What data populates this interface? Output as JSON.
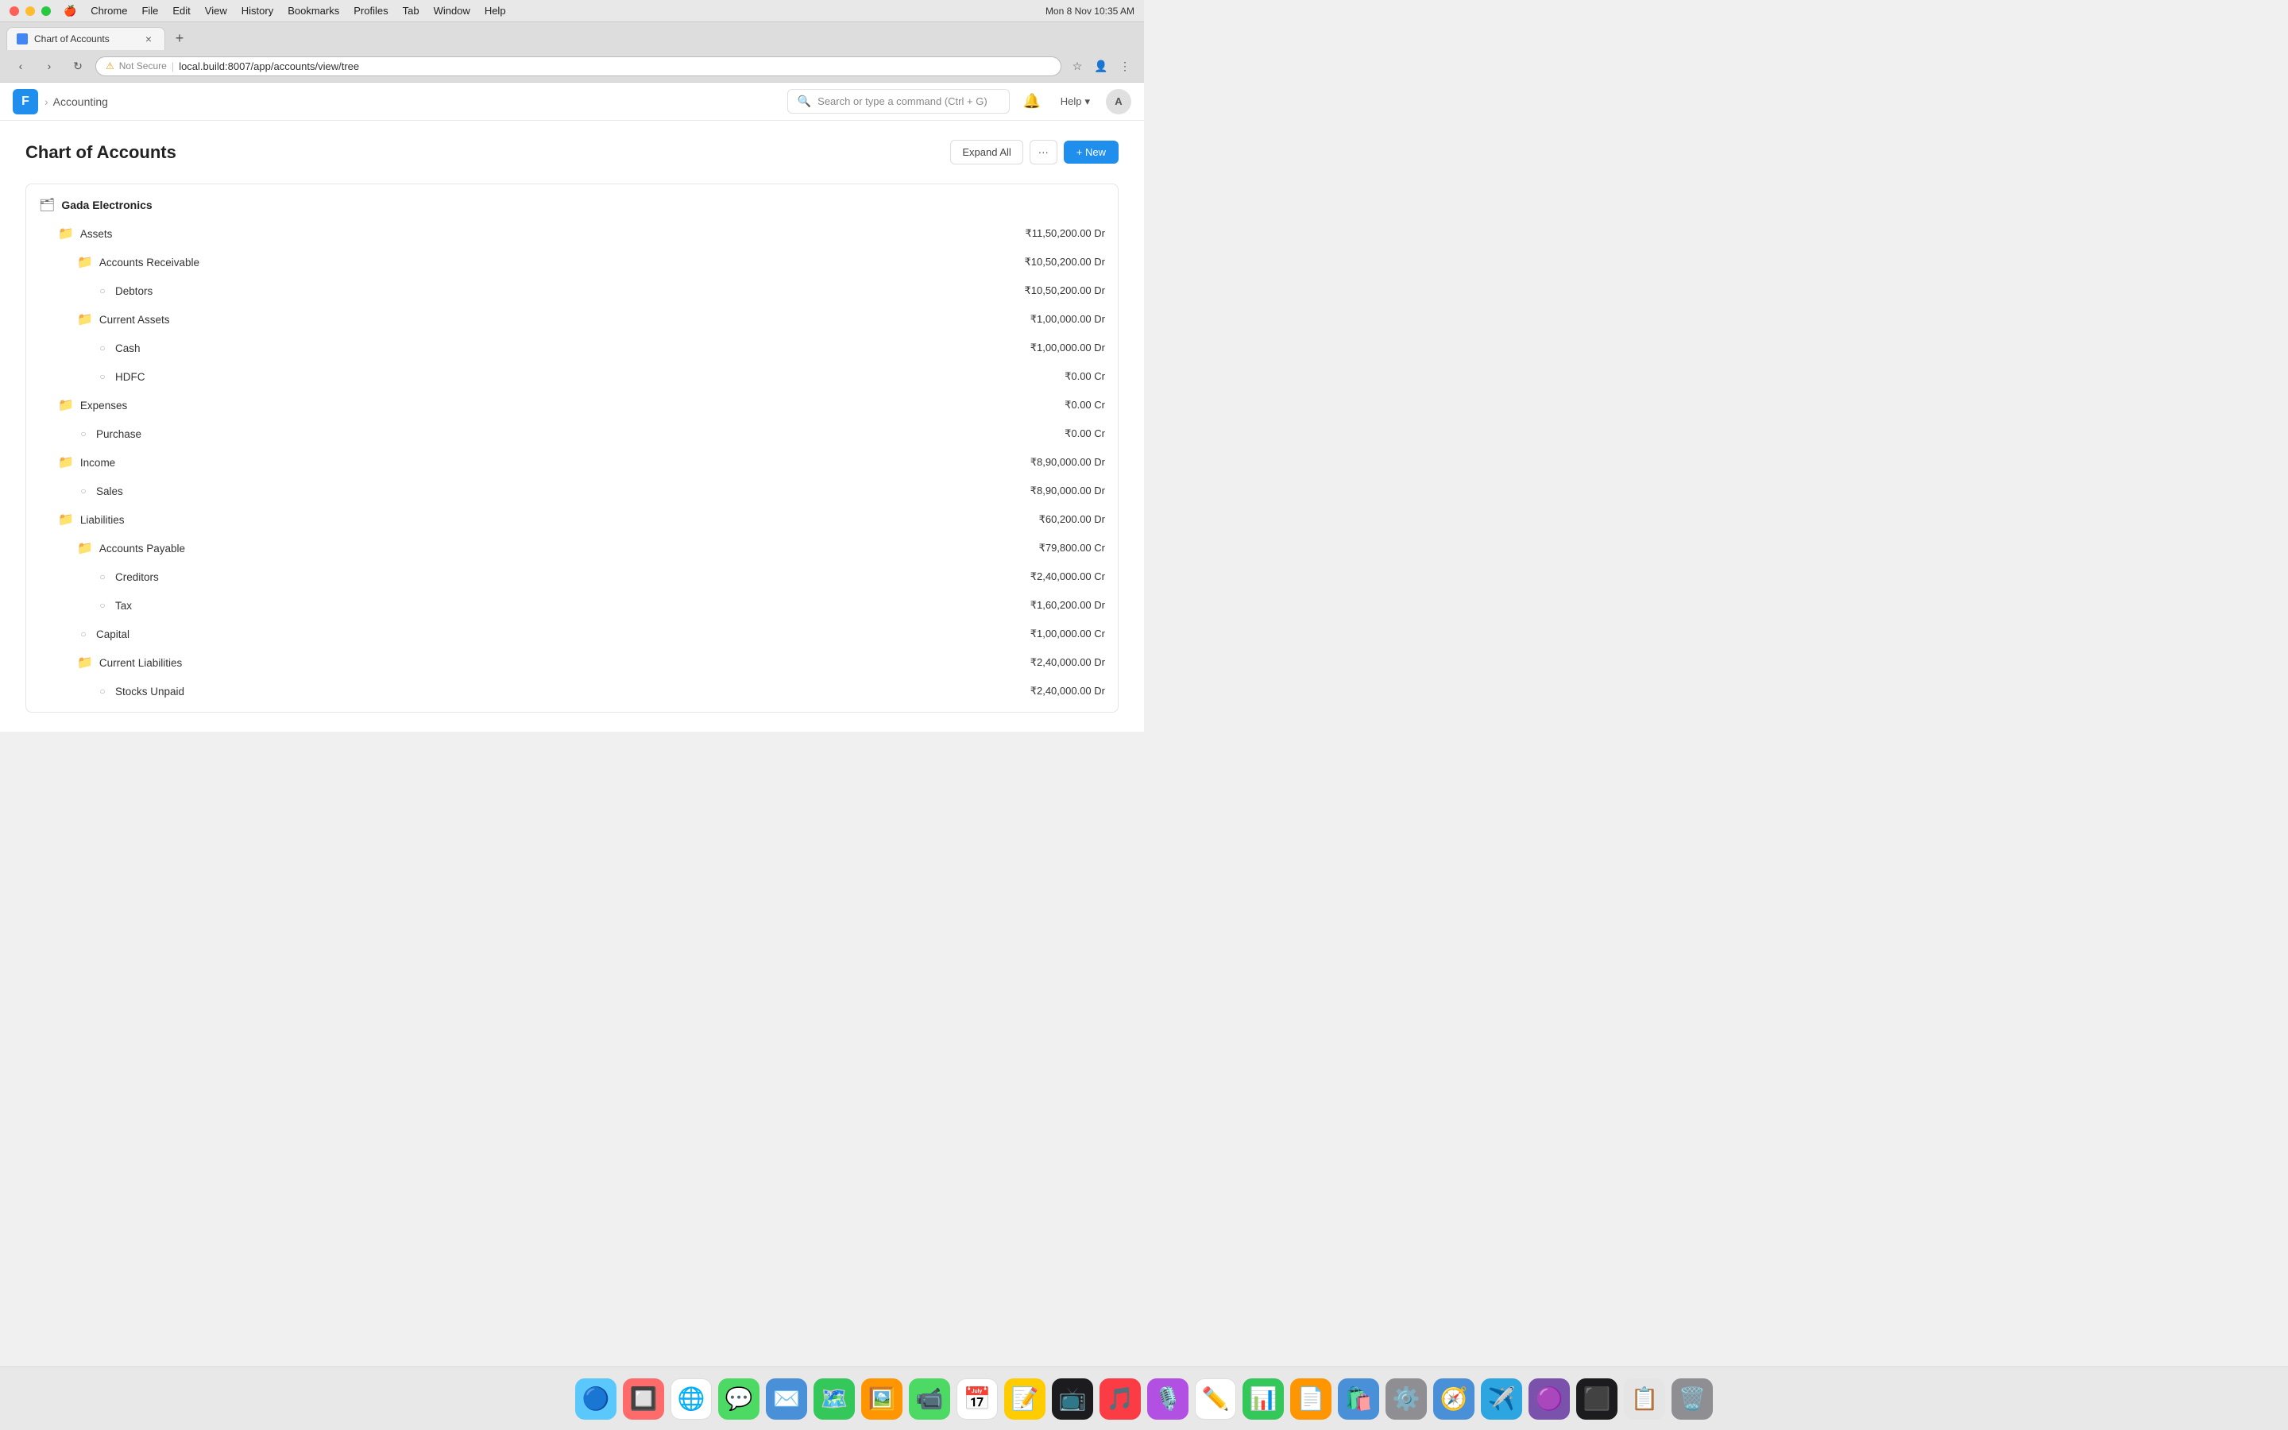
{
  "os": {
    "datetime": "Mon 8 Nov  10:35 AM",
    "menu_items": [
      "Chrome",
      "File",
      "Edit",
      "View",
      "History",
      "Bookmarks",
      "Profiles",
      "Tab",
      "Window",
      "Help"
    ]
  },
  "browser": {
    "tab_title": "Chart of Accounts",
    "url": "local.build:8007/app/accounts/view/tree",
    "url_display": "local.build",
    "url_path": ":8007/app/accounts/view/tree",
    "security_label": "Not Secure"
  },
  "app_nav": {
    "logo": "F",
    "breadcrumb_parent": "Accounting",
    "search_placeholder": "Search or type a command (Ctrl + G)",
    "help_label": "Help",
    "avatar_label": "A"
  },
  "page": {
    "title": "Chart of Accounts",
    "btn_expand_all": "Expand All",
    "btn_more": "···",
    "btn_new": "+ New"
  },
  "tree": {
    "company": "Gada Electronics",
    "items": [
      {
        "id": "assets",
        "label": "Assets",
        "type": "folder",
        "indent": 1,
        "amount": "₹11,50,200.00 Dr",
        "children": [
          {
            "id": "accounts-receivable",
            "label": "Accounts Receivable",
            "type": "folder",
            "indent": 2,
            "amount": "₹10,50,200.00 Dr",
            "children": [
              {
                "id": "debtors",
                "label": "Debtors",
                "type": "leaf",
                "indent": 3,
                "amount": "₹10,50,200.00 Dr"
              }
            ]
          },
          {
            "id": "current-assets",
            "label": "Current Assets",
            "type": "folder",
            "indent": 2,
            "amount": "₹1,00,000.00 Dr",
            "children": [
              {
                "id": "cash",
                "label": "Cash",
                "type": "leaf",
                "indent": 3,
                "amount": "₹1,00,000.00 Dr"
              },
              {
                "id": "hdfc",
                "label": "HDFC",
                "type": "leaf",
                "indent": 3,
                "amount": "₹0.00 Cr"
              }
            ]
          }
        ]
      },
      {
        "id": "expenses",
        "label": "Expenses",
        "type": "folder",
        "indent": 1,
        "amount": "₹0.00 Cr",
        "children": [
          {
            "id": "purchase",
            "label": "Purchase",
            "type": "leaf",
            "indent": 2,
            "amount": "₹0.00 Cr"
          }
        ]
      },
      {
        "id": "income",
        "label": "Income",
        "type": "folder",
        "indent": 1,
        "amount": "₹8,90,000.00 Dr",
        "children": [
          {
            "id": "sales",
            "label": "Sales",
            "type": "leaf",
            "indent": 2,
            "amount": "₹8,90,000.00 Dr"
          }
        ]
      },
      {
        "id": "liabilities",
        "label": "Liabilities",
        "type": "folder",
        "indent": 1,
        "amount": "₹60,200.00 Dr",
        "children": [
          {
            "id": "accounts-payable",
            "label": "Accounts Payable",
            "type": "folder",
            "indent": 2,
            "amount": "₹79,800.00 Cr",
            "children": [
              {
                "id": "creditors",
                "label": "Creditors",
                "type": "leaf",
                "indent": 3,
                "amount": "₹2,40,000.00 Cr"
              },
              {
                "id": "tax",
                "label": "Tax",
                "type": "leaf",
                "indent": 3,
                "amount": "₹1,60,200.00 Dr"
              }
            ]
          },
          {
            "id": "capital",
            "label": "Capital",
            "type": "leaf",
            "indent": 2,
            "amount": "₹1,00,000.00 Cr"
          },
          {
            "id": "current-liabilities",
            "label": "Current Liabilities",
            "type": "folder",
            "indent": 2,
            "amount": "₹2,40,000.00 Dr",
            "children": [
              {
                "id": "stocks-unpaid",
                "label": "Stocks Unpaid",
                "type": "leaf",
                "indent": 3,
                "amount": "₹2,40,000.00 Dr"
              }
            ]
          }
        ]
      }
    ]
  },
  "dock": {
    "items": [
      {
        "name": "finder",
        "icon": "🔵",
        "bg": "#5ac8fa"
      },
      {
        "name": "launchpad",
        "icon": "🔲",
        "bg": "#ff6b6b"
      },
      {
        "name": "chrome",
        "icon": "🌐",
        "bg": "#fff"
      },
      {
        "name": "messages",
        "icon": "💬",
        "bg": "#4cd964"
      },
      {
        "name": "mail",
        "icon": "✉️",
        "bg": "#4a90d9"
      },
      {
        "name": "maps",
        "icon": "🗺️",
        "bg": "#34c759"
      },
      {
        "name": "photos",
        "icon": "🖼️",
        "bg": "#ff9500"
      },
      {
        "name": "facetime",
        "icon": "📹",
        "bg": "#4cd964"
      },
      {
        "name": "calendar",
        "icon": "📅",
        "bg": "#ff3b30"
      },
      {
        "name": "notes",
        "icon": "📝",
        "bg": "#ffcc00"
      },
      {
        "name": "tv",
        "icon": "📺",
        "bg": "#1c1c1e"
      },
      {
        "name": "music",
        "icon": "🎵",
        "bg": "#fc3c44"
      },
      {
        "name": "podcasts",
        "icon": "🎙️",
        "bg": "#b150e2"
      },
      {
        "name": "freeform",
        "icon": "✏️",
        "bg": "#fff"
      },
      {
        "name": "numbers",
        "icon": "📊",
        "bg": "#34c759"
      },
      {
        "name": "pages",
        "icon": "📄",
        "bg": "#ff9500"
      },
      {
        "name": "app-store",
        "icon": "🛍️",
        "bg": "#4a90d9"
      },
      {
        "name": "system-prefs",
        "icon": "⚙️",
        "bg": "#8e8e93"
      },
      {
        "name": "safari",
        "icon": "🧭",
        "bg": "#4a90d9"
      },
      {
        "name": "telegram",
        "icon": "✈️",
        "bg": "#2ca5e0"
      },
      {
        "name": "elytra",
        "icon": "🟣",
        "bg": "#7b52ab"
      },
      {
        "name": "terminal",
        "icon": "⬛",
        "bg": "#1c1c1e"
      },
      {
        "name": "file-icon",
        "icon": "📋",
        "bg": "#e5e5e5"
      },
      {
        "name": "trash",
        "icon": "🗑️",
        "bg": "#8e8e93"
      }
    ]
  }
}
